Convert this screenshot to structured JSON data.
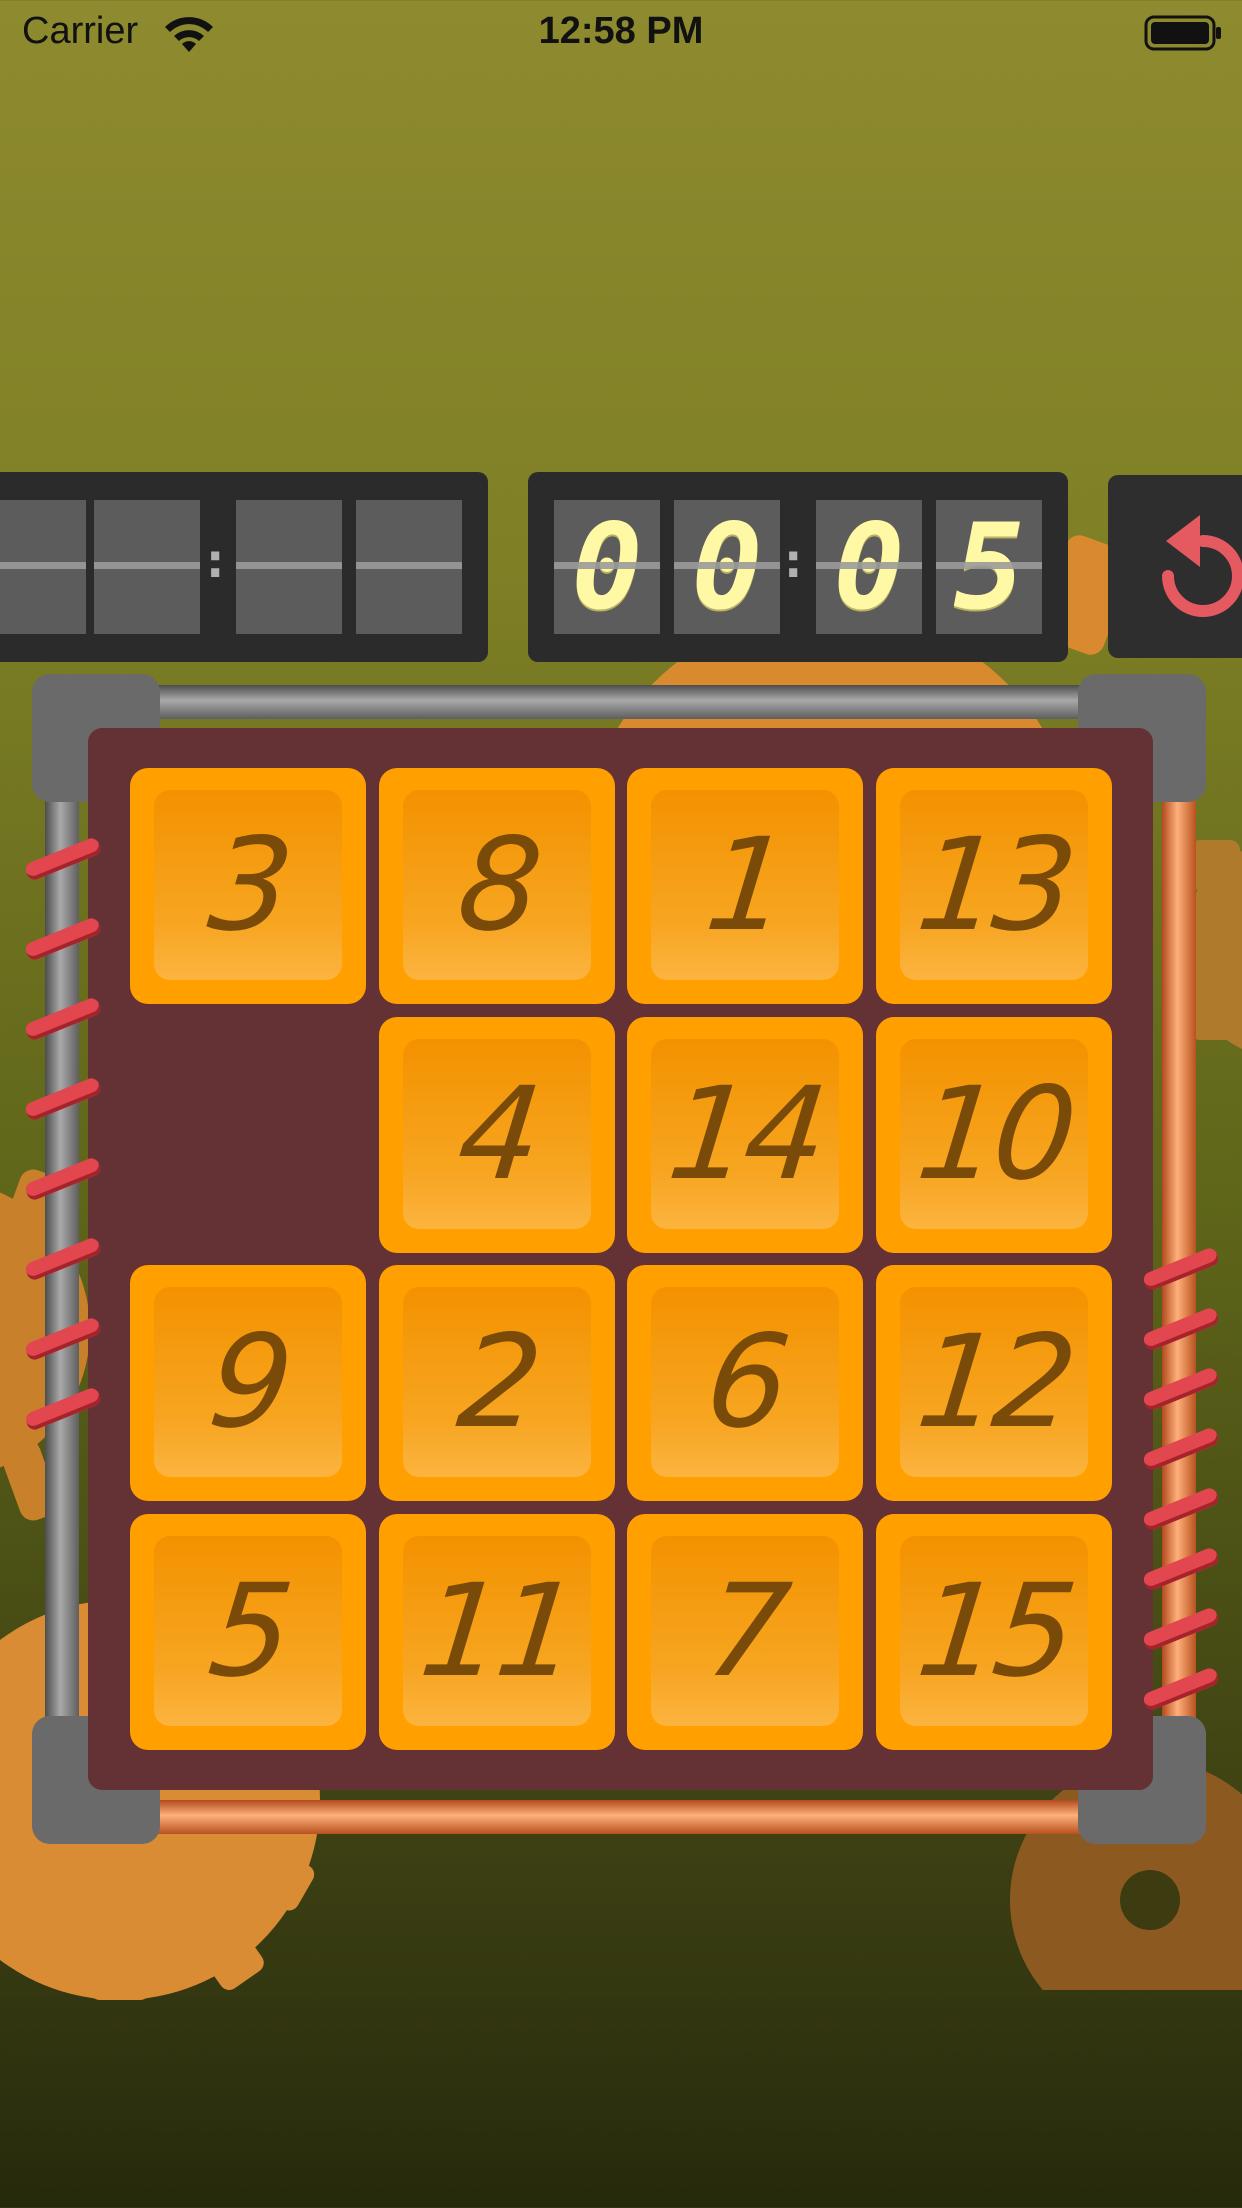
{
  "status_bar": {
    "carrier": "Carrier",
    "time": "12:58 PM",
    "wifi_icon": "wifi-icon",
    "battery_icon": "battery-full-icon"
  },
  "best_time": {
    "digits": [
      "",
      "",
      "",
      ""
    ],
    "colon": ":"
  },
  "current_time": {
    "digits": [
      "0",
      "0",
      "0",
      "5"
    ],
    "colon": ":"
  },
  "restart_button": {
    "icon": "restart-icon",
    "color": "#e55a60"
  },
  "puzzle": {
    "rows": [
      [
        "3",
        "8",
        "1",
        "13"
      ],
      [
        "",
        "4",
        "14",
        "10"
      ],
      [
        "9",
        "2",
        "6",
        "12"
      ],
      [
        "5",
        "11",
        "7",
        "15"
      ]
    ]
  },
  "colors": {
    "tile": "#ff9f00",
    "tile_text": "#7a4a08",
    "board": "#643234",
    "timer_digit": "#fff9a6"
  }
}
